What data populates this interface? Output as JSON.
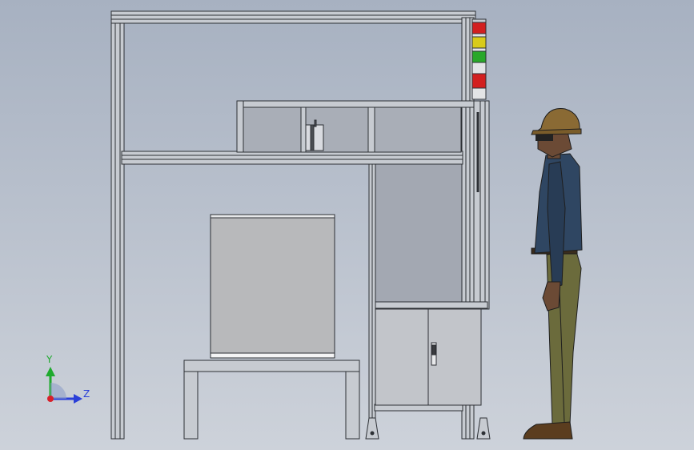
{
  "triad": {
    "y_label": "Y",
    "z_label": "Z",
    "colors": {
      "y": "#1faa2e",
      "z": "#2a3fd8",
      "x": "#d8202a"
    }
  },
  "colors": {
    "background_top": "#a7b1c1",
    "background_bottom": "#cdd2da",
    "frame": "#c7cbd1",
    "frame_edge": "#2d3035",
    "panel_glass": "#a9aeb7",
    "box": "#b8b9bb",
    "light_red": "#d21f1f",
    "light_yellow": "#d8cb1a",
    "light_green": "#29a829",
    "helmet": "#8a6a34",
    "shirt": "#2f4662",
    "pants": "#6b6b3c",
    "shoes": "#5b3d1f",
    "skin": "#6b4a35"
  }
}
